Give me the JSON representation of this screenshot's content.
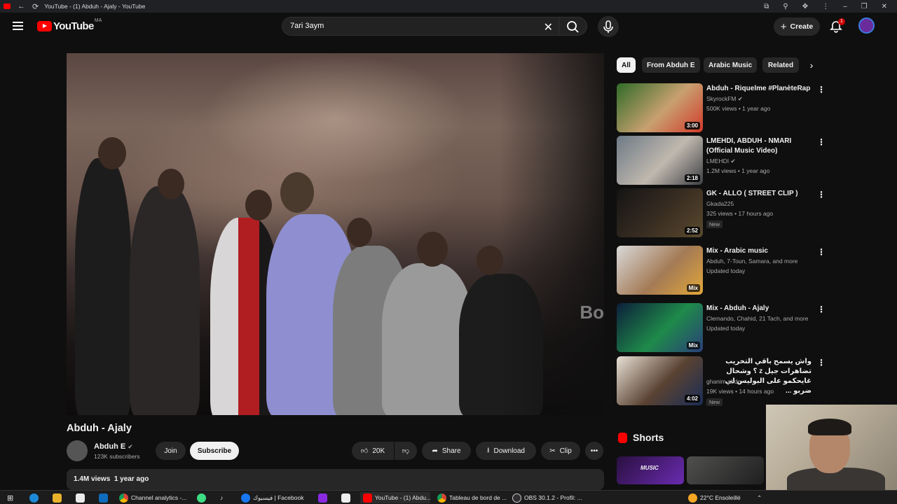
{
  "browser": {
    "tab_title": "YouTube - (1) Abduh - Ajaly - YouTube",
    "back_glyph": "←",
    "reload_glyph": "⟳",
    "controls": [
      "–",
      "❐",
      "✕"
    ]
  },
  "masthead": {
    "logo_text": "YouTube",
    "country_code": "MA",
    "search_value": "7ari 3aym",
    "create_label": "Create",
    "notification_count": "1"
  },
  "video": {
    "title": "Abduh - Ajaly",
    "channel_name": "Abduh E",
    "subscribers": "123K subscribers",
    "join_label": "Join",
    "subscribe_label": "Subscribe",
    "likes": "20K",
    "share_label": "Share",
    "download_label": "Download",
    "clip_label": "Clip",
    "views": "1.4M views",
    "age": "1 year ago",
    "watermark": "Bo"
  },
  "chips": [
    "All",
    "From Abduh E",
    "Arabic Music",
    "Related"
  ],
  "recommendations": [
    {
      "title": "Abduh - Riquelme #PlanèteRap",
      "channel": "SkyrockFM",
      "verified": true,
      "meta": "500K views • 1 year ago",
      "duration": "3:00",
      "badge": "",
      "colors": [
        "#2f6b28",
        "#c8a070",
        "#d23a2a"
      ]
    },
    {
      "title": "LMEHDI, ABDUH - NMARI (Official Music Video)",
      "channel": "LMEHDI",
      "verified": true,
      "meta": "1.2M views • 1 year ago",
      "duration": "2:18",
      "badge": "",
      "colors": [
        "#6d7a86",
        "#c0b8ae",
        "#3c3f44"
      ]
    },
    {
      "title": "GK - ALLO ( STREET CLIP )",
      "channel": "Gkada225",
      "verified": false,
      "meta": "325 views • 17 hours ago",
      "duration": "2:52",
      "badge": "New",
      "colors": [
        "#141414",
        "#3a2e22",
        "#5a4a2e"
      ]
    },
    {
      "title": "Mix - Arabic music",
      "channel": "Abduh, 7-Toun, Samara, and more",
      "verified": false,
      "meta": "Updated today",
      "duration": "Mix",
      "badge": "",
      "colors": [
        "#d9d9d9",
        "#a37a55",
        "#e2a73a"
      ]
    },
    {
      "title": "Mix - Abduh - Ajaly",
      "channel": "Clemando, Chahid, 21 Tach, and more",
      "verified": false,
      "meta": "Updated today",
      "duration": "Mix",
      "badge": "",
      "colors": [
        "#0c1e3a",
        "#1f8a4a",
        "#2a3f7a"
      ]
    },
    {
      "title": "واش يسمح باقي التخريب تضاهرات جيل z ؟ وشحال غايحكمو على البوليس لي ضربو ...",
      "channel": "ghanim abdo",
      "verified": false,
      "meta": "19K views • 14 hours ago",
      "duration": "4:02",
      "badge": "New",
      "colors": [
        "#e8e1d6",
        "#5a4232",
        "#1a2d55"
      ]
    }
  ],
  "shorts": {
    "title": "Shorts",
    "short1_text": "MUSIC"
  },
  "taskbar": {
    "items": [
      "Channel analytics -...",
      "فيسبوك | Facebook",
      "YouTube - (1) Abdu...",
      "Tableau de bord de ...",
      "OBS 30.1.2 - Profil: ..."
    ],
    "weather": "22°C  Ensoleillé"
  },
  "icons": {
    "search": "search-icon",
    "mic": "mic-icon",
    "bell": "bell-icon",
    "more": "more-vert-icon"
  }
}
